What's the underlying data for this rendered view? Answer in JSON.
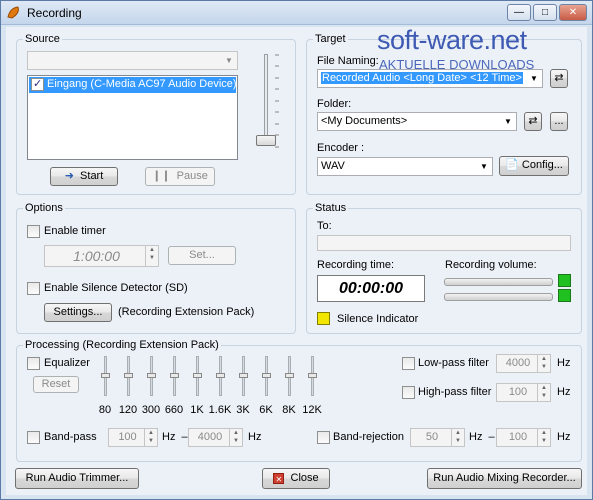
{
  "window": {
    "title": "Recording"
  },
  "watermark": {
    "brand": "soft-ware.net",
    "tagline": "AKTUELLE DOWNLOADS"
  },
  "source": {
    "group_title": "Source",
    "device_combo_value": "",
    "devices": [
      {
        "label": "Eingang (C-Media AC97 Audio Device)",
        "checked": true
      }
    ],
    "start_label": "Start",
    "pause_label": "Pause",
    "volume_level": 0.0
  },
  "target": {
    "group_title": "Target",
    "file_naming_label": "File Naming:",
    "file_naming_value": "Recorded Audio <Long Date> <12 Time>",
    "folder_label": "Folder:",
    "folder_value": "<My Documents>",
    "browse_label": "...",
    "encoder_label": "Encoder :",
    "encoder_value": "WAV",
    "config_label": "Config..."
  },
  "options": {
    "group_title": "Options",
    "enable_timer_label": "Enable timer",
    "timer_value": "1:00:00",
    "set_label": "Set...",
    "silence_detector_label": "Enable Silence Detector (SD)",
    "settings_label": "Settings...",
    "extension_pack_label": "(Recording Extension Pack)"
  },
  "status": {
    "group_title": "Status",
    "to_label": "To:",
    "to_value": "",
    "recording_time_label": "Recording time:",
    "recording_time_value": "00:00:00",
    "recording_volume_label": "Recording volume:",
    "silence_indicator_label": "Silence Indicator",
    "silence_indicator_color": "#f2e600",
    "level_led_color": "#20c020"
  },
  "processing": {
    "group_title": "Processing (Recording Extension Pack)",
    "equalizer_label": "Equalizer",
    "reset_label": "Reset",
    "eq_bands": [
      "80",
      "120",
      "300",
      "660",
      "1K",
      "1.6K",
      "3K",
      "6K",
      "8K",
      "12K"
    ],
    "lowpass_label": "Low-pass filter",
    "lowpass_value": "4000",
    "highpass_label": "High-pass filter",
    "highpass_value": "100",
    "hz_unit": "Hz",
    "bandpass_label": "Band-pass",
    "bandpass_low": "100",
    "bandpass_high": "4000",
    "bandrejection_label": "Band-rejection",
    "bandrejection_low": "50",
    "bandrejection_high": "100",
    "hz_dash": "Hz  –"
  },
  "footer": {
    "trimmer_label": "Run Audio Trimmer...",
    "close_label": "Close",
    "mixing_label": "Run Audio Mixing Recorder..."
  }
}
